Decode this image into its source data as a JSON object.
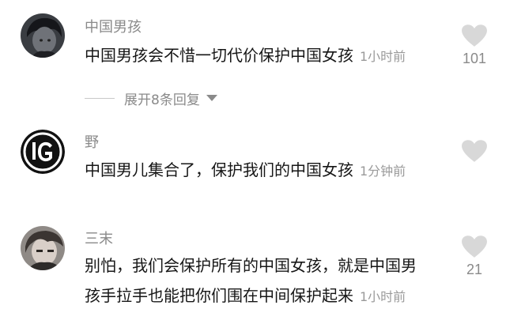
{
  "comments": [
    {
      "username": "中国男孩",
      "text": "中国男孩会不惜一切代价保护中国女孩",
      "time": "1小时前",
      "likes": "101",
      "avatar": "dark-haired-boy-avatar"
    },
    {
      "username": "野",
      "text": "中国男儿集合了，保护我们的中国女孩",
      "time": "1分钟前",
      "likes": "",
      "avatar": "ig-logo-avatar"
    },
    {
      "username": "三末",
      "text_line1": "别怕，我们会保护所有的中国女孩，就是中国男",
      "text_line2": "孩手拉手也能把你们围在中间保护起来",
      "time": "1小时前",
      "likes": "21",
      "avatar": "anime-character-avatar"
    }
  ],
  "expand_replies": {
    "label": "展开8条回复"
  },
  "colors": {
    "heart": "#d8d8d8",
    "username": "#8a8a8a",
    "text": "#161616"
  }
}
